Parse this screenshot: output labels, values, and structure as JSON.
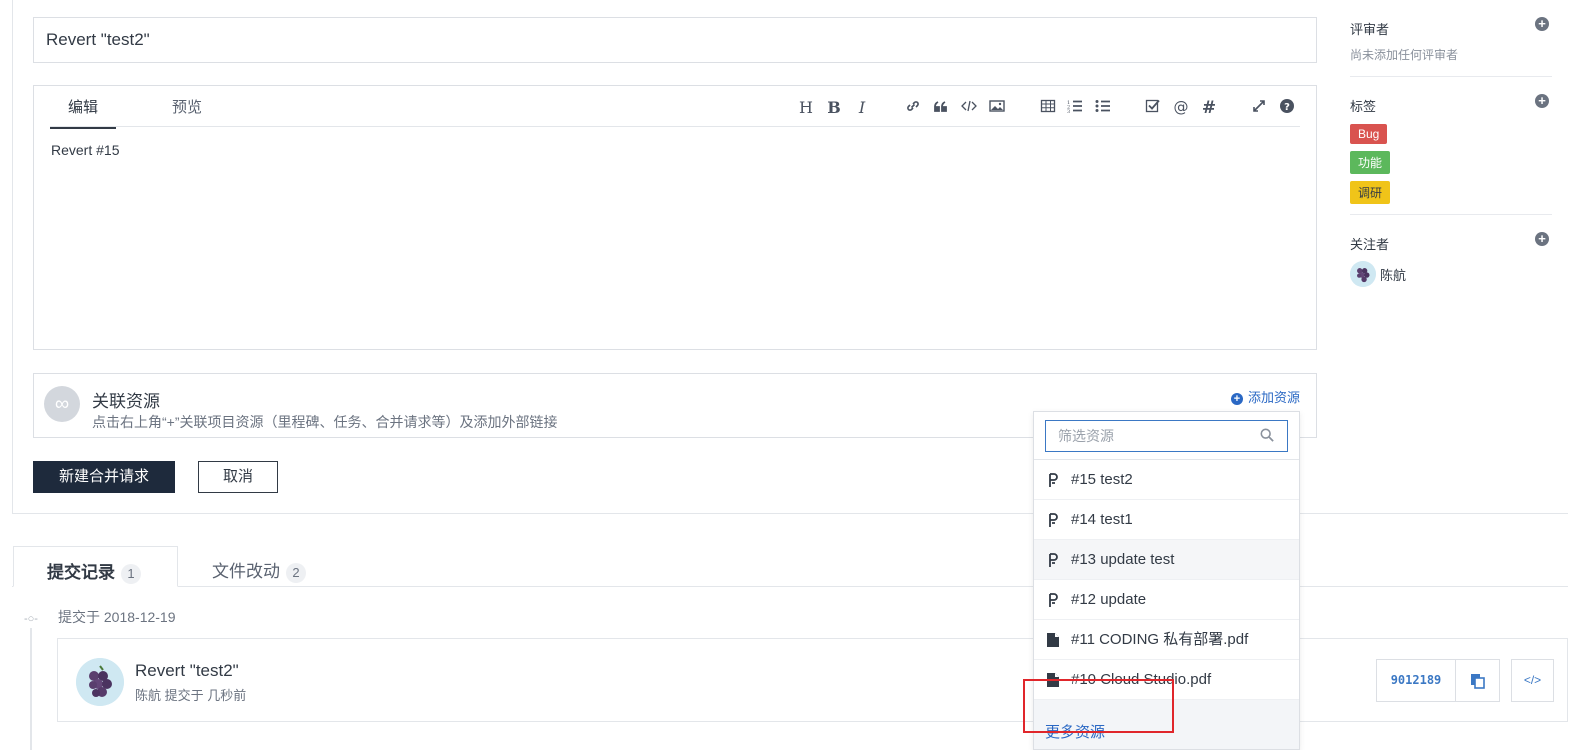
{
  "form": {
    "title_value": "Revert \"test2\"",
    "editor_tabs": {
      "edit": "编辑",
      "preview": "预览"
    },
    "toolbar": [
      "H",
      "B",
      "I"
    ],
    "body_text": "Revert #15",
    "linked": {
      "title": "关联资源",
      "description": "点击右上角“+”关联项目资源（里程碑、任务、合并请求等）及添加外部链接",
      "add_label": "添加资源"
    },
    "submit_label": "新建合并请求",
    "cancel_label": "取消"
  },
  "dropdown": {
    "placeholder": "筛选资源",
    "items": [
      {
        "label": "#15 test2",
        "icon": "merge-request-icon"
      },
      {
        "label": "#14 test1",
        "icon": "merge-request-icon"
      },
      {
        "label": "#13 update test",
        "icon": "merge-request-icon"
      },
      {
        "label": "#12 update",
        "icon": "merge-request-icon"
      },
      {
        "label": "#11 CODING 私有部署.pdf",
        "icon": "file-icon"
      },
      {
        "label": "#10 Cloud Studio.pdf",
        "icon": "file-icon"
      }
    ],
    "more_label": "更多资源"
  },
  "tabs": {
    "commits": {
      "label": "提交记录",
      "count": "1"
    },
    "files": {
      "label": "文件改动",
      "count": "2"
    }
  },
  "commits": {
    "date_label": "提交于 2018-12-19",
    "items": [
      {
        "title": "Revert \"test2\"",
        "meta": "陈航 提交于 几秒前",
        "sha": "9012189"
      }
    ]
  },
  "sidebar": {
    "reviewers": {
      "title": "评审者",
      "empty": "尚未添加任何评审者"
    },
    "labels": {
      "title": "标签",
      "items": [
        {
          "name": "Bug",
          "color": "#d9534f"
        },
        {
          "name": "功能",
          "color": "#5cb85c"
        },
        {
          "name": "调研",
          "color": "#f0c419"
        }
      ]
    },
    "watchers": {
      "title": "关注者",
      "users": [
        "陈航"
      ]
    }
  },
  "colors": {
    "primary": "#1e2a3c",
    "link": "#2a68c4",
    "highlight": "#e0262b"
  }
}
